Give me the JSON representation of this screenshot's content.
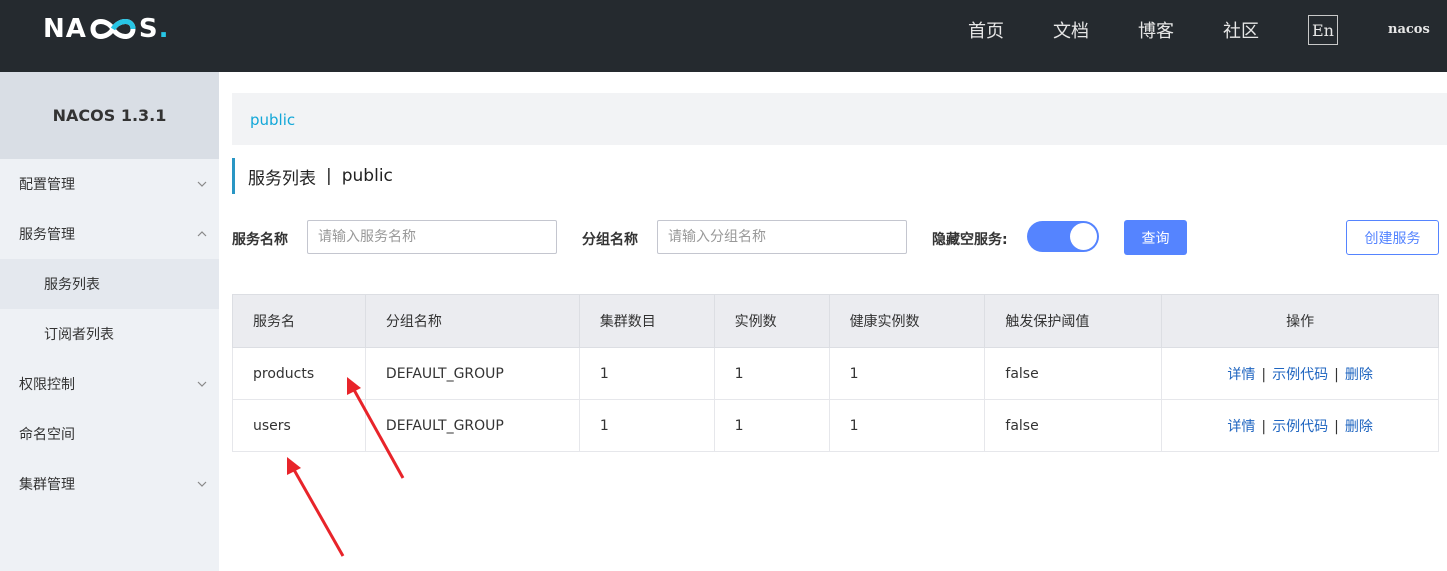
{
  "header": {
    "logo_left": "NA",
    "logo_right": "S",
    "logo_dot": ".",
    "nav": [
      "首页",
      "文档",
      "博客",
      "社区"
    ],
    "lang": "En",
    "user": "nacos"
  },
  "sidebar": {
    "title": "NACOS 1.3.1",
    "items": [
      {
        "label": "配置管理",
        "chevron": "down"
      },
      {
        "label": "服务管理",
        "chevron": "up"
      },
      {
        "label": "服务列表",
        "sub": true,
        "active": true
      },
      {
        "label": "订阅者列表",
        "sub": true
      },
      {
        "label": "权限控制",
        "chevron": "down"
      },
      {
        "label": "命名空间"
      },
      {
        "label": "集群管理",
        "chevron": "down"
      }
    ]
  },
  "breadcrumb": "public",
  "page_title": {
    "main": "服务列表",
    "separator": "|",
    "namespace": "public"
  },
  "filters": {
    "service_label": "服务名称",
    "service_placeholder": "请输入服务名称",
    "group_label": "分组名称",
    "group_placeholder": "请输入分组名称",
    "hide_empty_label": "隐藏空服务:",
    "query_button": "查询",
    "create_button": "创建服务"
  },
  "table": {
    "columns": [
      "服务名",
      "分组名称",
      "集群数目",
      "实例数",
      "健康实例数",
      "触发保护阈值",
      "操作"
    ],
    "rows": [
      {
        "name": "products",
        "group": "DEFAULT_GROUP",
        "clusters": "1",
        "instances": "1",
        "healthy": "1",
        "threshold": "false"
      },
      {
        "name": "users",
        "group": "DEFAULT_GROUP",
        "clusters": "1",
        "instances": "1",
        "healthy": "1",
        "threshold": "false"
      }
    ],
    "ops": {
      "detail": "详情",
      "sample": "示例代码",
      "delete": "删除",
      "sep": "|"
    }
  },
  "colors": {
    "accent": "#5584ff",
    "link": "#1f65c0",
    "header_bg": "#252a2f",
    "annotation": "#e8242a"
  }
}
